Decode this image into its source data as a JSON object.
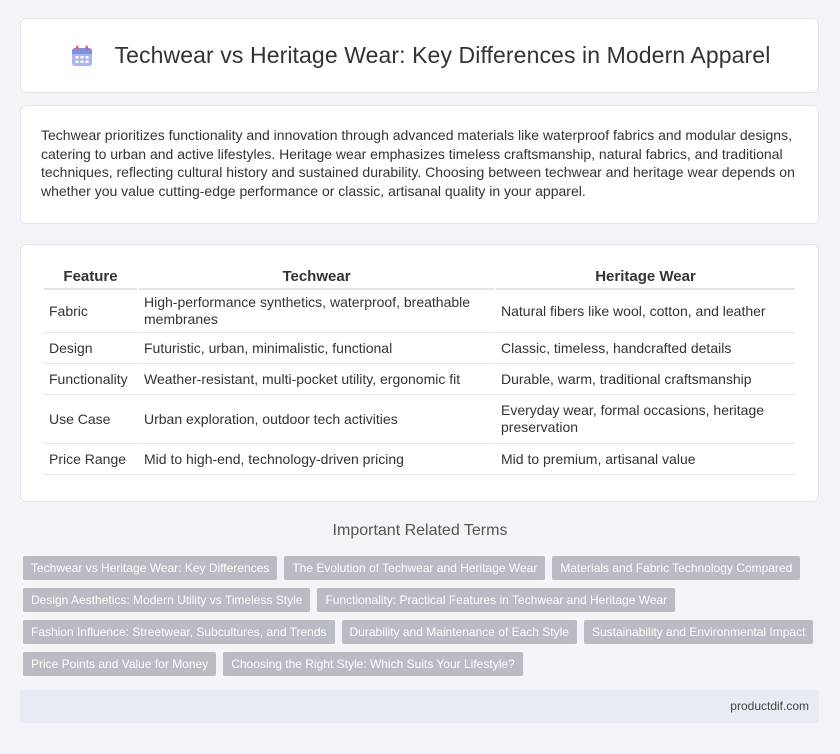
{
  "header": {
    "title": "Techwear vs Heritage Wear: Key Differences in Modern Apparel",
    "icon": "calendar-icon"
  },
  "intro": {
    "text": "Techwear prioritizes functionality and innovation through advanced materials like waterproof fabrics and modular designs, catering to urban and active lifestyles. Heritage wear emphasizes timeless craftsmanship, natural fabrics, and traditional techniques, reflecting cultural history and sustained durability. Choosing between techwear and heritage wear depends on whether you value cutting-edge performance or classic, artisanal quality in your apparel."
  },
  "table": {
    "headers": [
      "Feature",
      "Techwear",
      "Heritage Wear"
    ],
    "rows": [
      [
        "Fabric",
        "High-performance synthetics, waterproof, breathable membranes",
        "Natural fibers like wool, cotton, and leather"
      ],
      [
        "Design",
        "Futuristic, urban, minimalistic, functional",
        "Classic, timeless, handcrafted details"
      ],
      [
        "Functionality",
        "Weather-resistant, multi-pocket utility, ergonomic fit",
        "Durable, warm, traditional craftsmanship"
      ],
      [
        "Use Case",
        "Urban exploration, outdoor tech activities",
        "Everyday wear, formal occasions, heritage preservation"
      ],
      [
        "Price Range",
        "Mid to high-end, technology-driven pricing",
        "Mid to premium, artisanal value"
      ]
    ]
  },
  "related": {
    "title": "Important Related Terms",
    "tags": [
      [
        "Techwear vs Heritage Wear: Key Differences",
        "The Evolution of Techwear and Heritage Wear",
        "Materials and Fabric Technology Compared"
      ],
      [
        "Design Aesthetics: Modern Utility vs Timeless Style",
        "Functionality: Practical Features in Techwear and Heritage Wear"
      ],
      [
        "Fashion Influence: Streetwear, Subcultures, and Trends",
        "Durability and Maintenance of Each Style",
        "Sustainability and Environmental Impact"
      ],
      [
        "Price Points and Value for Money",
        "Choosing the Right Style: Which Suits Your Lifestyle?"
      ]
    ]
  },
  "footer": {
    "site": "productdif.com"
  },
  "colors": {
    "tag_bg": "#b9bcc2",
    "footer_bg": "#e7ebf3",
    "page_bg": "#f3f4f7"
  }
}
